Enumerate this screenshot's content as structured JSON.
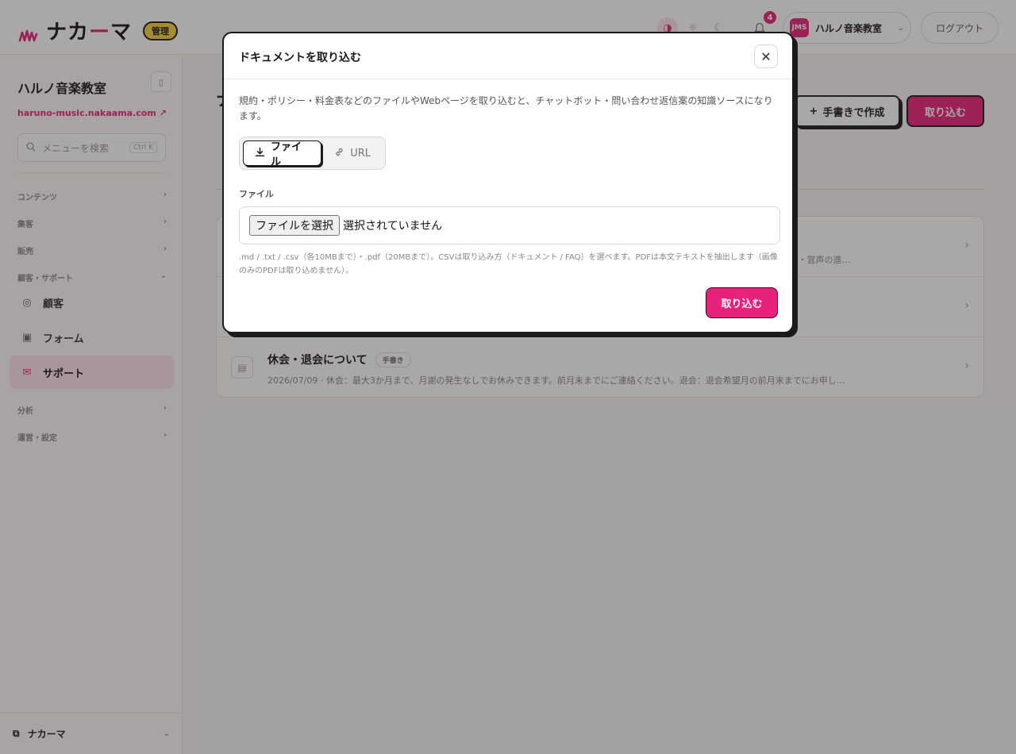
{
  "header": {
    "brand": "ナカーマ",
    "brand_pre": "ナカ",
    "brand_dash": "ー",
    "brand_post": "マ",
    "admin_badge": "管理",
    "notification_count": "4",
    "account_avatar": "JMS",
    "account_name": "ハルノ音楽教室",
    "logout_label": "ログアウト"
  },
  "sidebar": {
    "org_name": "ハルノ音楽教室",
    "org_url": "haruno-music.nakaama.com",
    "search_placeholder": "メニューを検索",
    "search_shortcut": "Ctrl K",
    "groups": [
      {
        "label": "コンテンツ"
      },
      {
        "label": "集客"
      },
      {
        "label": "販売"
      },
      {
        "label": "顧客・サポート"
      }
    ],
    "items": [
      {
        "label": "顧客"
      },
      {
        "label": "フォーム"
      },
      {
        "label": "サポート"
      }
    ],
    "groups_bottom": [
      {
        "label": "分析"
      },
      {
        "label": "運営・設定"
      }
    ],
    "footer_label": "ナカーマ"
  },
  "main": {
    "title_fragment": "ナ",
    "btn_manual": "手書きで作成",
    "btn_import": "取り込む",
    "rows": [
      {
        "title": "",
        "tag": "",
        "meta": "…ース・営声の進…"
      },
      {
        "title": "",
        "tag": "",
        "meta": ""
      },
      {
        "title": "休会・退会について",
        "tag": "手書き",
        "meta": "2026/07/09 · 休会：最大3か月まで、月謝の発生なしでお休みできます。前月末までにご連絡ください。退会：退会希望月の前月末までにお申し…"
      }
    ]
  },
  "modal": {
    "title": "ドキュメントを取り込む",
    "description": "規約・ポリシー・料金表などのファイルやWebページを取り込むと、チャットボット・問い合わせ返信案の知識ソースになります。",
    "tab_file": "ファイル",
    "tab_url": "URL",
    "field_label": "ファイル",
    "choose_button": "ファイルを選択",
    "file_status": "選択されていません",
    "help_text": ".md / .txt / .csv（各10MBまで）・.pdf（20MBまで）。CSVは取り込み方（ドキュメント / FAQ）を選べます。PDFは本文テキストを抽出します（画像のみのPDFは取り込めません）。",
    "submit_label": "取り込む"
  },
  "colors": {
    "accent": "#e8217a",
    "badge": "#f4d23c",
    "ink": "#1a1a1a"
  }
}
